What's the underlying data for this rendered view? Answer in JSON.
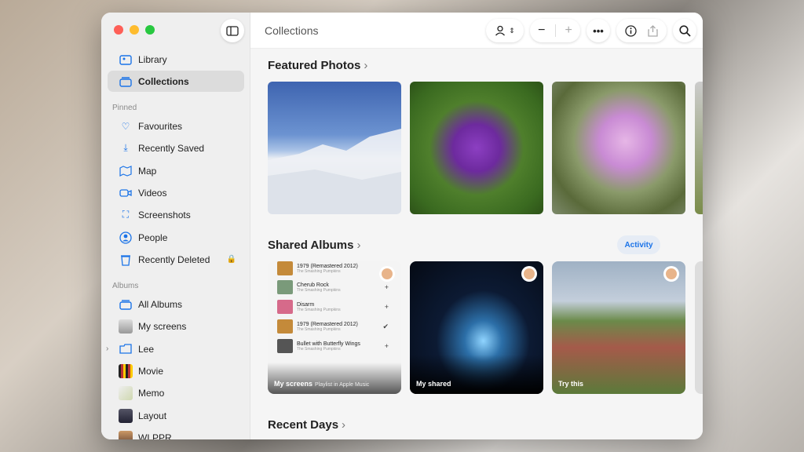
{
  "toolbar": {
    "title": "Collections"
  },
  "sidebar": {
    "library": "Library",
    "collections": "Collections",
    "pinned_header": "Pinned",
    "pinned": [
      "Favourites",
      "Recently Saved",
      "Map",
      "Videos",
      "Screenshots",
      "People",
      "Recently Deleted"
    ],
    "albums_header": "Albums",
    "albums": [
      "All Albums",
      "My screens",
      "Lee",
      "Movie",
      "Memo",
      "Layout",
      "WLPPR"
    ]
  },
  "sections": {
    "featured": "Featured Photos",
    "shared": "Shared Albums",
    "recent": "Recent Days",
    "activity": "Activity"
  },
  "shared_albums": [
    {
      "label": "My screens",
      "tracks": [
        {
          "title": "1979 (Remastered 2012)",
          "artist": "The Smashing Pumpkins"
        },
        {
          "title": "Cherub Rock",
          "artist": "The Smashing Pumpkins"
        },
        {
          "title": "Disarm",
          "artist": "The Smashing Pumpkins"
        },
        {
          "title": "1979 (Remastered 2012)",
          "artist": "The Smashing Pumpkins"
        },
        {
          "title": "Bullet with Butterfly Wings",
          "artist": "The Smashing Pumpkins"
        }
      ],
      "overlay": "Playlist in Apple Music"
    },
    {
      "label": "My shared"
    },
    {
      "label": "Try this"
    }
  ],
  "colors": {
    "accent": "#1a73e8"
  }
}
